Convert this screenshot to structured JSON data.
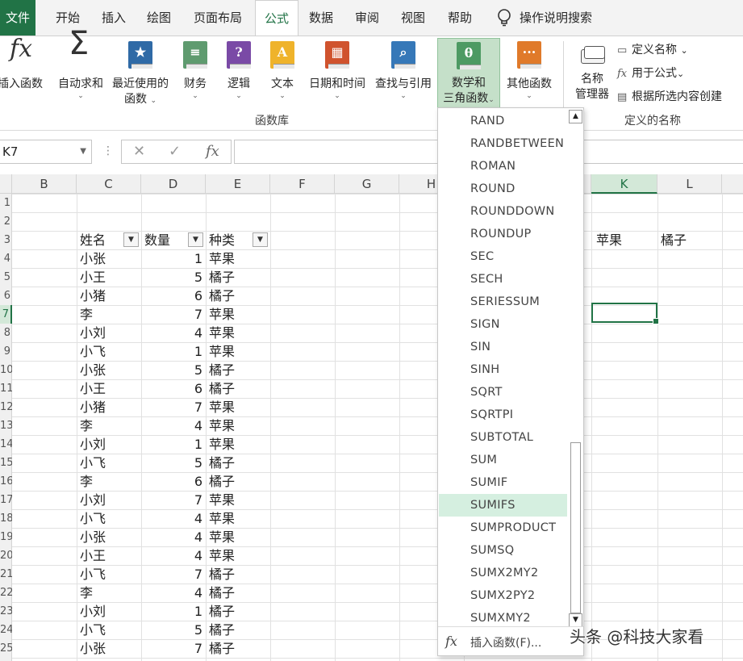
{
  "tabs": [
    {
      "label": "文件"
    },
    {
      "label": "开始"
    },
    {
      "label": "插入"
    },
    {
      "label": "绘图"
    },
    {
      "label": "页面布局"
    },
    {
      "label": "公式"
    },
    {
      "label": "数据"
    },
    {
      "label": "审阅"
    },
    {
      "label": "视图"
    },
    {
      "label": "帮助"
    },
    {
      "label": "操作说明搜索"
    }
  ],
  "ribbon": {
    "insert_function": "插入函数",
    "autosum": "自动求和",
    "recent_line1": "最近使用的",
    "recent_line2": "函数",
    "financial": "财务",
    "logical": "逻辑",
    "text": "文本",
    "datetime": "日期和时间",
    "lookup": "查找与引用",
    "math_line1": "数学和",
    "math_line2": "三角函数",
    "more": "其他函数",
    "name_mgr_line1": "名称",
    "name_mgr_line2": "管理器",
    "define_name": "定义名称",
    "use_in_formula": "用于公式",
    "create_from_sel": "根据所选内容创建",
    "group_library": "函数库",
    "group_names": "定义的名称"
  },
  "formula_bar": {
    "name_box": "K7",
    "fx_label": "fx",
    "formula": ""
  },
  "columns": [
    "B",
    "C",
    "D",
    "E",
    "F",
    "G",
    "H",
    "K",
    "L"
  ],
  "row_numbers": [
    "1",
    "2",
    "3",
    "4",
    "5",
    "6",
    "7",
    "8",
    "9",
    "10",
    "11",
    "12",
    "13",
    "14",
    "15",
    "16",
    "17",
    "18",
    "19",
    "20",
    "21",
    "22",
    "23",
    "24",
    "25"
  ],
  "table": {
    "headers": [
      "姓名",
      "数量",
      "种类"
    ],
    "rows": [
      [
        "小张",
        "1",
        "苹果"
      ],
      [
        "小王",
        "5",
        "橘子"
      ],
      [
        "小猪",
        "6",
        "橘子"
      ],
      [
        "李",
        "7",
        "苹果"
      ],
      [
        "小刘",
        "4",
        "苹果"
      ],
      [
        "小飞",
        "1",
        "苹果"
      ],
      [
        "小张",
        "5",
        "橘子"
      ],
      [
        "小王",
        "6",
        "橘子"
      ],
      [
        "小猪",
        "7",
        "苹果"
      ],
      [
        "李",
        "4",
        "苹果"
      ],
      [
        "小刘",
        "1",
        "苹果"
      ],
      [
        "小飞",
        "5",
        "橘子"
      ],
      [
        "李",
        "6",
        "橘子"
      ],
      [
        "小刘",
        "7",
        "苹果"
      ],
      [
        "小飞",
        "4",
        "苹果"
      ],
      [
        "小张",
        "4",
        "苹果"
      ],
      [
        "小王",
        "4",
        "苹果"
      ],
      [
        "小飞",
        "7",
        "橘子"
      ],
      [
        "李",
        "4",
        "橘子"
      ],
      [
        "小刘",
        "1",
        "橘子"
      ],
      [
        "小飞",
        "5",
        "橘子"
      ],
      [
        "小张",
        "7",
        "橘子"
      ]
    ]
  },
  "summary_headers": [
    "苹果",
    "橘子"
  ],
  "dropdown": {
    "items": [
      "RAND",
      "RANDBETWEEN",
      "ROMAN",
      "ROUND",
      "ROUNDDOWN",
      "ROUNDUP",
      "SEC",
      "SECH",
      "SERIESSUM",
      "SIGN",
      "SIN",
      "SINH",
      "SQRT",
      "SQRTPI",
      "SUBTOTAL",
      "SUM",
      "SUMIF",
      "SUMIFS",
      "SUMPRODUCT",
      "SUMSQ",
      "SUMX2MY2",
      "SUMX2PY2",
      "SUMXMY2"
    ],
    "highlighted": "SUMIFS",
    "footer": "插入函数(F)..."
  },
  "watermark": "头条 @科技大家看",
  "colors": {
    "accent": "#217346",
    "selected_ribbon": "#c5e0c9",
    "highlight_item": "#d5efe0"
  }
}
